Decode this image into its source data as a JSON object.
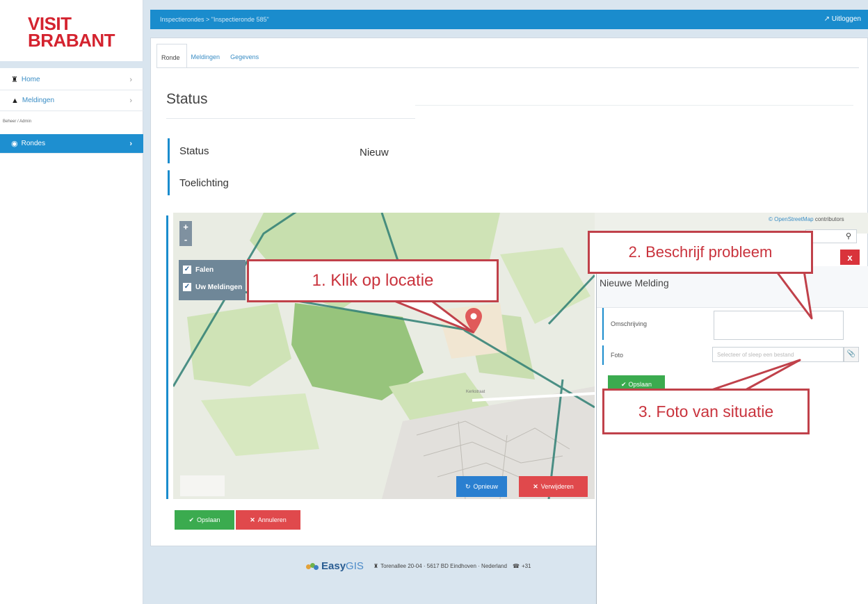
{
  "brand": {
    "line1": "VISIT",
    "line2": "BRABANT"
  },
  "sidebar": {
    "items": [
      {
        "label": "Home",
        "icon": "home-icon"
      },
      {
        "label": "Meldingen",
        "icon": "bullhorn-icon"
      }
    ],
    "section_label": "Beheer / Admin",
    "active_item": {
      "label": "Rondes",
      "icon": "eye-icon"
    }
  },
  "topbar": {
    "breadcrumb": "Inspectierondes > \"Inspectieronde 585\"",
    "logout_label": "Uitloggen"
  },
  "tabs": [
    "Ronde",
    "Meldingen",
    "Gegevens"
  ],
  "status": {
    "title": "Status",
    "rows": [
      {
        "label": "Status",
        "value": "Nieuw"
      },
      {
        "label": "Toelichting",
        "value": ""
      }
    ]
  },
  "map": {
    "zoom_in": "+",
    "zoom_out": "-",
    "layers": [
      "Falen",
      "Uw Meldingen"
    ],
    "attribution_link": "© OpenStreetMap",
    "attribution_rest": " contributors",
    "street_label": "Kerkstraat",
    "reset_label": "Opnieuw",
    "remove_label": "Verwijderen",
    "pin_color": "#e05a5a"
  },
  "form_buttons": {
    "save_label": "Opslaan",
    "cancel_label": "Annuleren"
  },
  "footer": {
    "logo_bold": "Easy",
    "logo_light": "GIS",
    "address": "Torenallee 20-04 · 5617 BD Eindhoven · Nederland",
    "phone": "+31"
  },
  "dialog": {
    "title": "Nieuwe Melding",
    "close_label": "x",
    "description_label": "Omschrijving",
    "photo_label": "Foto",
    "photo_placeholder": "Selecteer of sleep een bestand",
    "submit_label": "Opslaan"
  },
  "callouts": {
    "step1": "1. Klik op locatie",
    "step2": "2. Beschrijf probleem",
    "step3": "3. Foto van situatie"
  },
  "colors": {
    "brand_red": "#d4232f",
    "primary_blue": "#1a8ccd",
    "callout_red": "#c0414a",
    "success_green": "#3bab4f",
    "danger_red": "#e0494c"
  }
}
